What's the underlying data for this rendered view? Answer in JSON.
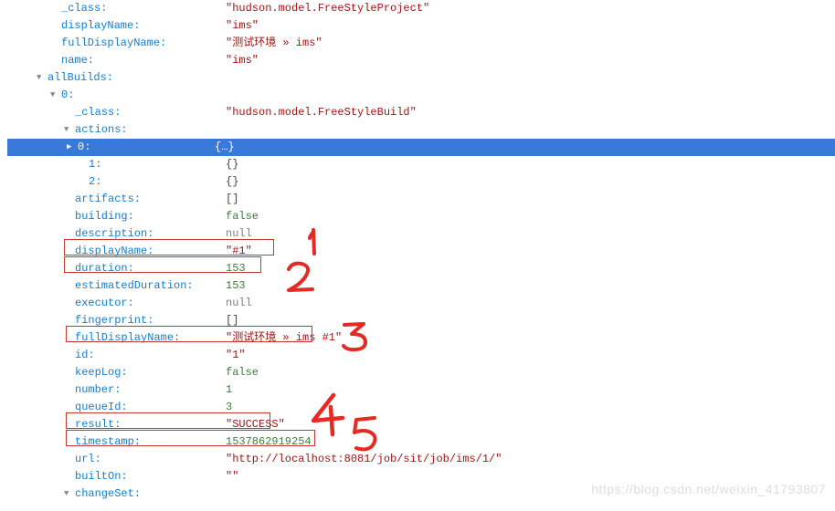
{
  "watermark": "https://blog.csdn.net/weixin_41793807",
  "annotations": {
    "a1": "1",
    "a2": "2",
    "a3": "3",
    "a4": "4",
    "a5": "5"
  },
  "rows": [
    {
      "indent": 1,
      "tri": "",
      "key": "_class:",
      "valText": "\"hudson.model.FreeStyleProject\"",
      "valClass": "val-str",
      "keyWidth": 180
    },
    {
      "indent": 1,
      "tri": "",
      "key": "displayName:",
      "valText": "\"ims\"",
      "valClass": "val-str",
      "keyWidth": 180
    },
    {
      "indent": 1,
      "tri": "",
      "key": "fullDisplayName:",
      "valText": "\"测试环境 » ims\"",
      "valClass": "val-str",
      "keyWidth": 180
    },
    {
      "indent": 1,
      "tri": "",
      "key": "name:",
      "valText": "\"ims\"",
      "valClass": "val-str",
      "keyWidth": 180
    },
    {
      "indent": 0,
      "tri": "▼",
      "key": "allBuilds:",
      "valText": "",
      "valClass": "",
      "keyWidth": 180
    },
    {
      "indent": 1,
      "tri": "▼",
      "key": "0:",
      "valText": "",
      "valClass": "",
      "keyWidth": 180
    },
    {
      "indent": 2,
      "tri": "",
      "key": "_class:",
      "valText": "\"hudson.model.FreeStyleBuild\"",
      "valClass": "val-str",
      "keyWidth": 165
    },
    {
      "indent": 2,
      "tri": "▼",
      "key": "actions:",
      "valText": "",
      "valClass": "",
      "keyWidth": 165
    },
    {
      "indent": 3,
      "tri": "▶",
      "key": "0:",
      "valText": "{…}",
      "valClass": "val-obj",
      "keyWidth": 150,
      "highlight": true
    },
    {
      "indent": 3,
      "tri": "",
      "key": "1:",
      "valText": "{}",
      "valClass": "val-sym",
      "keyWidth": 150
    },
    {
      "indent": 3,
      "tri": "",
      "key": "2:",
      "valText": "{}",
      "valClass": "val-sym",
      "keyWidth": 150
    },
    {
      "indent": 2,
      "tri": "",
      "key": "artifacts:",
      "valText": "[]",
      "valClass": "val-sym",
      "keyWidth": 165
    },
    {
      "indent": 2,
      "tri": "",
      "key": "building:",
      "valText": "false",
      "valClass": "val-bool",
      "keyWidth": 165
    },
    {
      "indent": 2,
      "tri": "",
      "key": "description:",
      "valText": "null",
      "valClass": "val-null",
      "keyWidth": 165
    },
    {
      "indent": 2,
      "tri": "",
      "key": "displayName:",
      "valText": "\"#1\"",
      "valClass": "val-str",
      "keyWidth": 165
    },
    {
      "indent": 2,
      "tri": "",
      "key": "duration:",
      "valText": "153",
      "valClass": "val-num",
      "keyWidth": 165
    },
    {
      "indent": 2,
      "tri": "",
      "key": "estimatedDuration:",
      "valText": "153",
      "valClass": "val-num",
      "keyWidth": 165
    },
    {
      "indent": 2,
      "tri": "",
      "key": "executor:",
      "valText": "null",
      "valClass": "val-null",
      "keyWidth": 165
    },
    {
      "indent": 2,
      "tri": "",
      "key": "fingerprint:",
      "valText": "[]",
      "valClass": "val-sym",
      "keyWidth": 165
    },
    {
      "indent": 2,
      "tri": "",
      "key": "fullDisplayName:",
      "valText": "\"测试环境 » ims #1\"",
      "valClass": "val-str",
      "keyWidth": 165
    },
    {
      "indent": 2,
      "tri": "",
      "key": "id:",
      "valText": "\"1\"",
      "valClass": "val-str",
      "keyWidth": 165
    },
    {
      "indent": 2,
      "tri": "",
      "key": "keepLog:",
      "valText": "false",
      "valClass": "val-bool",
      "keyWidth": 165
    },
    {
      "indent": 2,
      "tri": "",
      "key": "number:",
      "valText": "1",
      "valClass": "val-num",
      "keyWidth": 165
    },
    {
      "indent": 2,
      "tri": "",
      "key": "queueId:",
      "valText": "3",
      "valClass": "val-num",
      "keyWidth": 165
    },
    {
      "indent": 2,
      "tri": "",
      "key": "result:",
      "valText": "\"SUCCESS\"",
      "valClass": "val-str",
      "keyWidth": 165
    },
    {
      "indent": 2,
      "tri": "",
      "key": "timestamp:",
      "valText": "1537862919254",
      "valClass": "val-num",
      "keyWidth": 165
    },
    {
      "indent": 2,
      "tri": "",
      "key": "url:",
      "valText": "\"http://localhost:8081/job/sit/job/ims/1/\"",
      "valClass": "val-str",
      "keyWidth": 165
    },
    {
      "indent": 2,
      "tri": "",
      "key": "builtOn:",
      "valText": "\"\"",
      "valClass": "val-str",
      "keyWidth": 165
    },
    {
      "indent": 2,
      "tri": "▼",
      "key": "changeSet:",
      "valText": "",
      "valClass": "",
      "keyWidth": 165
    }
  ]
}
